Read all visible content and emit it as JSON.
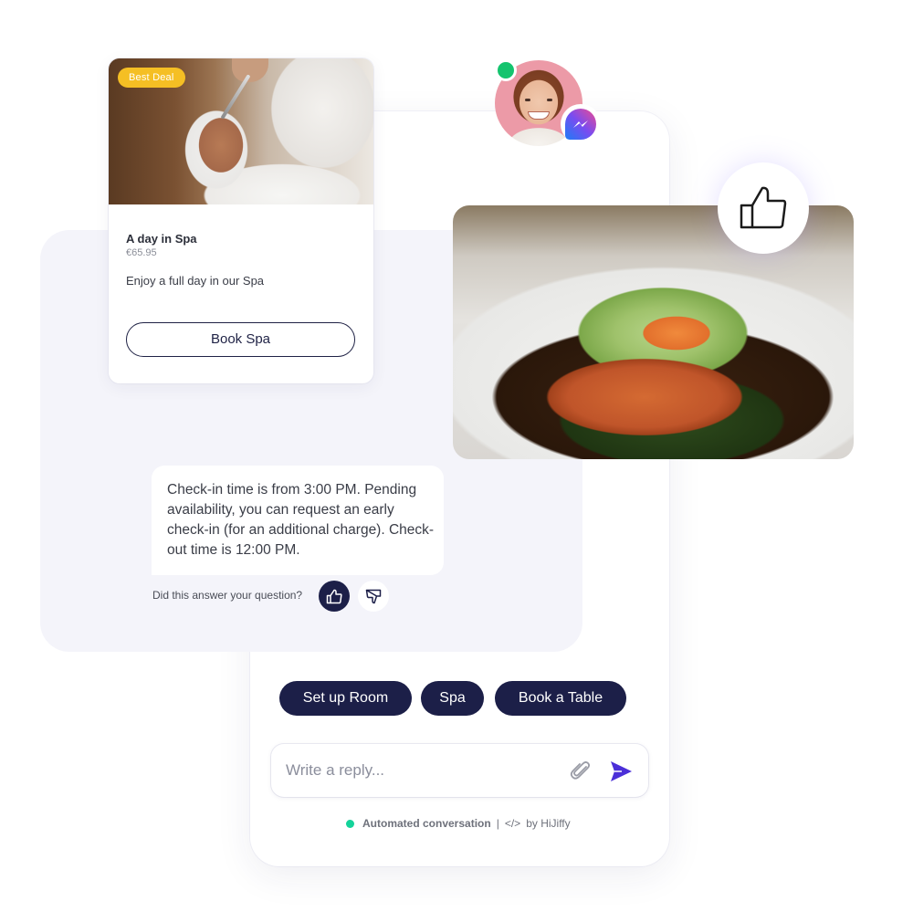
{
  "colors": {
    "navy": "#1c1f48",
    "badge_yellow": "#f5bf24",
    "online_green": "#14c46e",
    "automated_dot": "#14d39a",
    "send_purple": "#4b2fd8",
    "backdrop": "#f4f4fa"
  },
  "spa_card": {
    "badge": "Best Deal",
    "title": "A day in Spa",
    "price": "€65.95",
    "description": "Enjoy a full day in our Spa",
    "button_label": "Book Spa"
  },
  "agent": {
    "status": "online",
    "channel_icon": "messenger-icon"
  },
  "reaction_badge": {
    "icon": "thumbs-up-icon"
  },
  "message": {
    "text": "Check-in time is from 3:00 PM. Pending availability, you can request an early check-in (for an additional charge). Check-out time is 12:00 PM."
  },
  "feedback": {
    "label": "Did this answer your question?",
    "up_icon": "thumbs-up-icon",
    "down_icon": "thumbs-down-icon"
  },
  "quick_replies": [
    {
      "label": "Set up Room"
    },
    {
      "label": "Spa"
    },
    {
      "label": "Book a Table"
    }
  ],
  "reply": {
    "placeholder": "Write a reply...",
    "value": "",
    "attach_icon": "paperclip-icon",
    "send_icon": "send-icon"
  },
  "footer": {
    "status": "Automated conversation",
    "separator": "|",
    "code_glyph": "</>",
    "by": "by HiJiffy"
  }
}
